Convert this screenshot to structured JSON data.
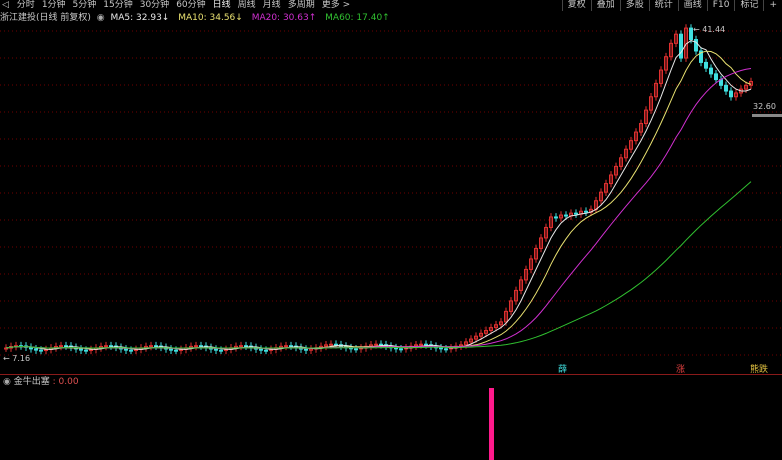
{
  "toolbar": {
    "back": "◁",
    "periods": [
      "分时",
      "1分钟",
      "5分钟",
      "15分钟",
      "30分钟",
      "60分钟",
      "日线",
      "周线",
      "月线",
      "多周期",
      "更多 >"
    ],
    "active_period": "日线",
    "right_tools": [
      "复权",
      "叠加",
      "多股",
      "统计",
      "画线",
      "F10",
      "标记",
      "+"
    ]
  },
  "info": {
    "title": "浙江建投(日线 前复权)",
    "ma5": "MA5: 32.93↓",
    "ma10": "MA10: 34.56↓",
    "ma20": "MA20: 30.63↑",
    "ma60": "MA60: 17.40↑"
  },
  "colors": {
    "ma5": "#e8e8e8",
    "ma10": "#e8e070",
    "ma20": "#d030d0",
    "ma60": "#30c030",
    "up": "#e03030",
    "down": "#40e0e0",
    "bg": "#000000",
    "grid": "#700000"
  },
  "price": {
    "high": "41.44",
    "current": "32.60",
    "low": "7.16"
  },
  "markers": [
    {
      "text": "薛",
      "color": "#40e0e0"
    },
    {
      "text": "涨",
      "color": "#e04040"
    },
    {
      "text": "熊跌",
      "color": "#e0c040"
    }
  ],
  "indicator": {
    "name": "金牛出塞",
    "value": ": 0.00",
    "signal_color": "#ff1a8c"
  }
}
